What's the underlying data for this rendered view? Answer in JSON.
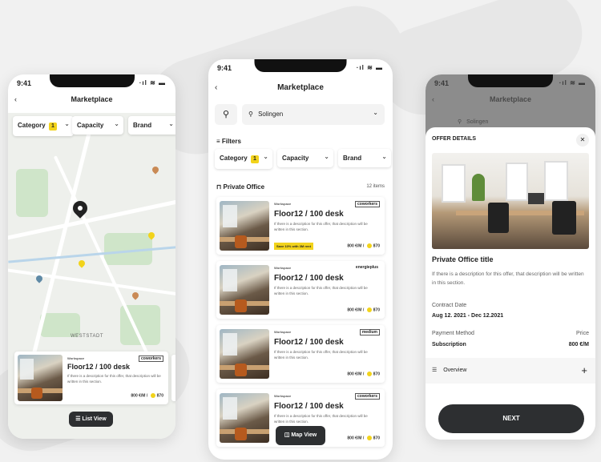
{
  "status": {
    "time": "9:41",
    "signal": "·ıl ≋ ▬"
  },
  "left": {
    "title": "Marketplace",
    "chips": {
      "category": "Category",
      "category_count": "1",
      "capacity": "Capacity",
      "brand": "Brand"
    },
    "map_label": "WESTSTADT",
    "card": {
      "tag": "Workspace",
      "brand": "coworkers",
      "title": "Floor12 / 100 desk",
      "desc": "If there is a description for this offer, that description will be written in this section.",
      "price": "800 €/M",
      "coins": "870"
    },
    "list_view_button": "List View"
  },
  "middle": {
    "title": "Marketplace",
    "location": "Solingen",
    "filters_label": "Filters",
    "chips": {
      "category": "Category",
      "category_count": "1",
      "capacity": "Capacity",
      "brand": "Brand"
    },
    "section_title": "Private Office",
    "items_count": "12 items",
    "cards": [
      {
        "tag": "Workspace",
        "brand": "coworkers",
        "title": "Floor12 / 100 desk",
        "desc": "If there is a description for this offer, that description will be written in this section.",
        "promo": "Save 10% with 3M rent",
        "price": "800 €/M",
        "coins": "870"
      },
      {
        "tag": "Workspace",
        "brand": "energieplus",
        "title": "Floor12 / 100 desk",
        "desc": "If there is a description for this offer, that description will be written in this section.",
        "promo": "",
        "price": "800 €/M",
        "coins": "870"
      },
      {
        "tag": "Workspace",
        "brand": "medium",
        "title": "Floor12 / 100 desk",
        "desc": "If there is a description for this offer, that description will be written in this section.",
        "promo": "",
        "price": "800 €/M",
        "coins": "870"
      },
      {
        "tag": "Workspace",
        "brand": "coworkers",
        "title": "Floor12 / 100 desk",
        "desc": "If there is a description for this offer, that description will be written in this section.",
        "promo": "",
        "price": "800 €/M",
        "coins": "870"
      }
    ],
    "map_view_button": "Map View"
  },
  "right": {
    "bg_title": "Marketplace",
    "bg_location": "Solingen",
    "sheet_title": "OFFER DETAILS",
    "offer_title": "Private Office title",
    "offer_desc": "If there is a description for this offer, that description will be written in this section.",
    "contract_label": "Contract Date",
    "contract_value": "Aug 12. 2021 - Dec 12.2021",
    "payment_label": "Payment Method",
    "payment_value": "Subscription",
    "price_label": "Price",
    "price_value": "800 €/M",
    "overview_label": "Overview",
    "next_button": "NEXT"
  },
  "colors": {
    "accent": "#f2d31b",
    "dark": "#2d2f31",
    "map_green": "#cfe5c9"
  }
}
